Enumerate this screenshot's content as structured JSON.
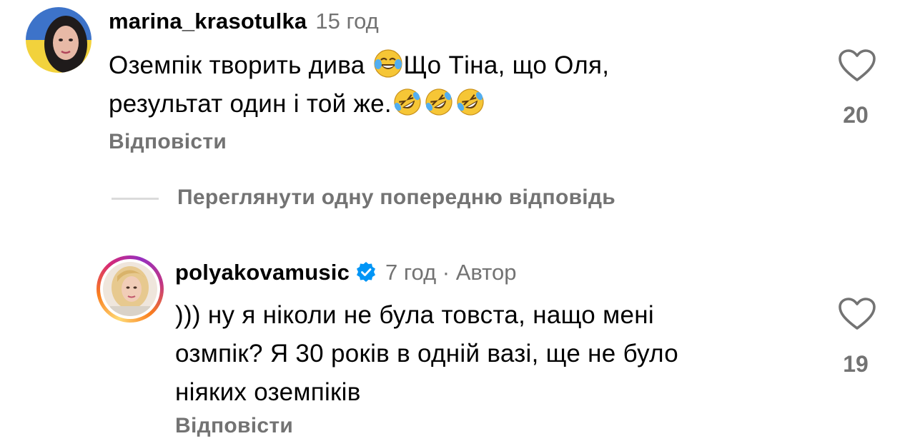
{
  "comments": [
    {
      "username": "marina_krasotulka",
      "time": "15 год",
      "text_line1": "Оземпік  творить дива ",
      "text_line1_b": "Що Тіна, що Оля,",
      "text_line2": "результат один і той же.",
      "emoji": [
        "face-with-tears-of-joy",
        "rolling-on-the-floor-laughing"
      ],
      "likes": "20",
      "reply_label": "Відповісти"
    },
    {
      "username": "polyakovamusic",
      "verified": true,
      "time": "7 год · Автор",
      "text_line1": "))) ну я ніколи не була товста, нащо мені",
      "text_line2": "озмпік? Я 30 років в одній вазі, ще не було",
      "text_line3": "ніяких оземпіків",
      "likes": "19",
      "reply_label": "Відповісти"
    }
  ],
  "view_previous_label": "Переглянути одну попередню відповідь",
  "colors": {
    "text": "#000000",
    "secondary": "#737373",
    "divider": "#dbdbdb",
    "verified": "#0095f6"
  },
  "icons": {
    "like": "heart-outline-icon",
    "verified": "verified-badge-icon"
  }
}
